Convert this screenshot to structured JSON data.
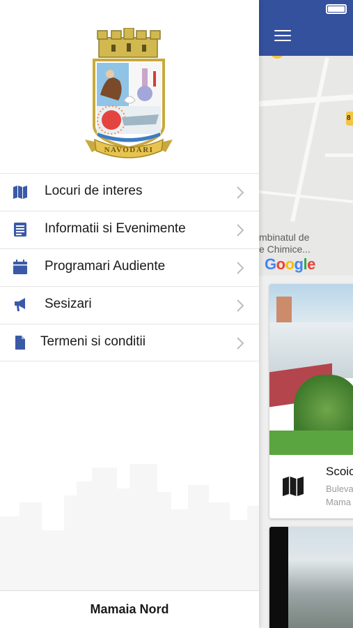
{
  "drawer": {
    "logo": {
      "name": "navodari-coat-of-arms",
      "text": "NAVODARI"
    },
    "menu": [
      {
        "label": "Locuri de interes",
        "icon": "map-icon"
      },
      {
        "label": "Informatii si Evenimente",
        "icon": "news-icon"
      },
      {
        "label": "Programari Audiente",
        "icon": "calendar-icon"
      },
      {
        "label": "Sesizari",
        "icon": "megaphone-icon"
      },
      {
        "label": "Termeni si conditii",
        "icon": "document-icon"
      }
    ],
    "footer": {
      "label": "Mamaia Nord"
    }
  },
  "app": {
    "header": {
      "menu_icon": "hamburger-icon",
      "status": "battery-icon"
    },
    "map": {
      "label_line1": "mbinatul de",
      "label_line2": "e Chimice...",
      "attribution": "Google",
      "road_shield": "8"
    },
    "cards": [
      {
        "title": "Scoic",
        "subtitle_line1": "Buleva",
        "subtitle_line2": "Mama",
        "icon": "map-icon"
      },
      {
        "title": "",
        "subtitle_line1": "",
        "subtitle_line2": ""
      }
    ]
  },
  "colors": {
    "brand_blue": "#34519e",
    "icon_blue": "#3a5aa8",
    "divider": "#e4e4e4",
    "chevron": "#bdbdbd"
  }
}
